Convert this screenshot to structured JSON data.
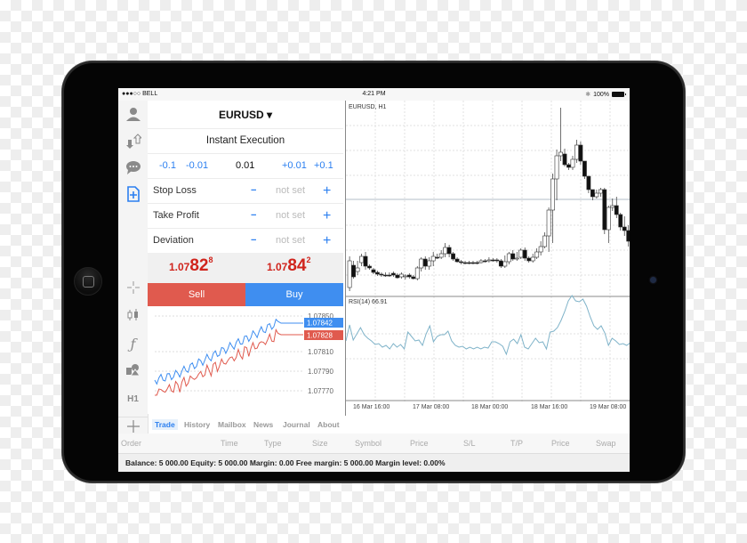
{
  "status_bar": {
    "carrier": "●●●○○ BELL",
    "wifi_icon": "wifi-icon",
    "time": "4:21 PM",
    "bluetooth": "✱",
    "battery": "100%"
  },
  "sidebar": {
    "items": [
      {
        "icon": "account-icon",
        "glyph": "👤"
      },
      {
        "icon": "trade-arrows-icon",
        "glyph": "⇅"
      },
      {
        "icon": "chat-icon",
        "glyph": "💬"
      },
      {
        "icon": "new-order-icon",
        "glyph": "⊞",
        "active": true
      },
      {
        "icon": "crosshair-icon",
        "glyph": "+"
      },
      {
        "icon": "candlestick-icon",
        "glyph": "▯▮"
      },
      {
        "icon": "indicator-icon",
        "glyph": "ƒ"
      },
      {
        "icon": "objects-icon",
        "glyph": "▲"
      },
      {
        "icon": "timeframe-icon",
        "glyph": "H1"
      },
      {
        "icon": "add-icon",
        "glyph": "+"
      }
    ]
  },
  "order": {
    "symbol": "EURUSD ▾",
    "execution": "Instant Execution",
    "volume": {
      "minus_large": "-0.1",
      "minus_small": "-0.01",
      "value": "0.01",
      "plus_small": "+0.01",
      "plus_large": "+0.1"
    },
    "params": [
      {
        "label": "Stop Loss",
        "minus": "−",
        "value": "not set",
        "plus": "+"
      },
      {
        "label": "Take Profit",
        "minus": "−",
        "value": "not set",
        "plus": "+"
      },
      {
        "label": "Deviation",
        "minus": "−",
        "value": "not set",
        "plus": "+"
      }
    ],
    "bid": {
      "prefix": "1.07",
      "big": "82",
      "sup": "8"
    },
    "ask": {
      "prefix": "1.07",
      "big": "84",
      "sup": "2"
    },
    "sell_label": "Sell",
    "buy_label": "Buy"
  },
  "tick_chart": {
    "levels": [
      "1.07850",
      "1.07810",
      "1.07790",
      "1.07770"
    ],
    "ask_label": "1.07842",
    "bid_label": "1.07828",
    "ask_color": "#3f8ef0",
    "bid_color": "#e05a4e"
  },
  "tabs": [
    {
      "label": "Trade",
      "active": true
    },
    {
      "label": "History"
    },
    {
      "label": "Mailbox"
    },
    {
      "label": "News"
    },
    {
      "label": "Journal"
    },
    {
      "label": "About"
    }
  ],
  "chart": {
    "title": "EURUSD, H1",
    "indicator_label": "RSI(14) 66.91",
    "x_labels": [
      "16 Mar 16:00",
      "17 Mar 08:00",
      "18 Mar 00:00",
      "18 Mar 16:00",
      "19 Mar 08:00"
    ]
  },
  "table_headers": [
    "Order",
    "Time",
    "Type",
    "Size",
    "Symbol",
    "Price",
    "S/L",
    "T/P",
    "Price",
    "Swap"
  ],
  "balance_text": "Balance: 5 000.00 Equity: 5 000.00 Margin: 0.00 Free margin: 5 000.00 Margin level: 0.00%"
}
